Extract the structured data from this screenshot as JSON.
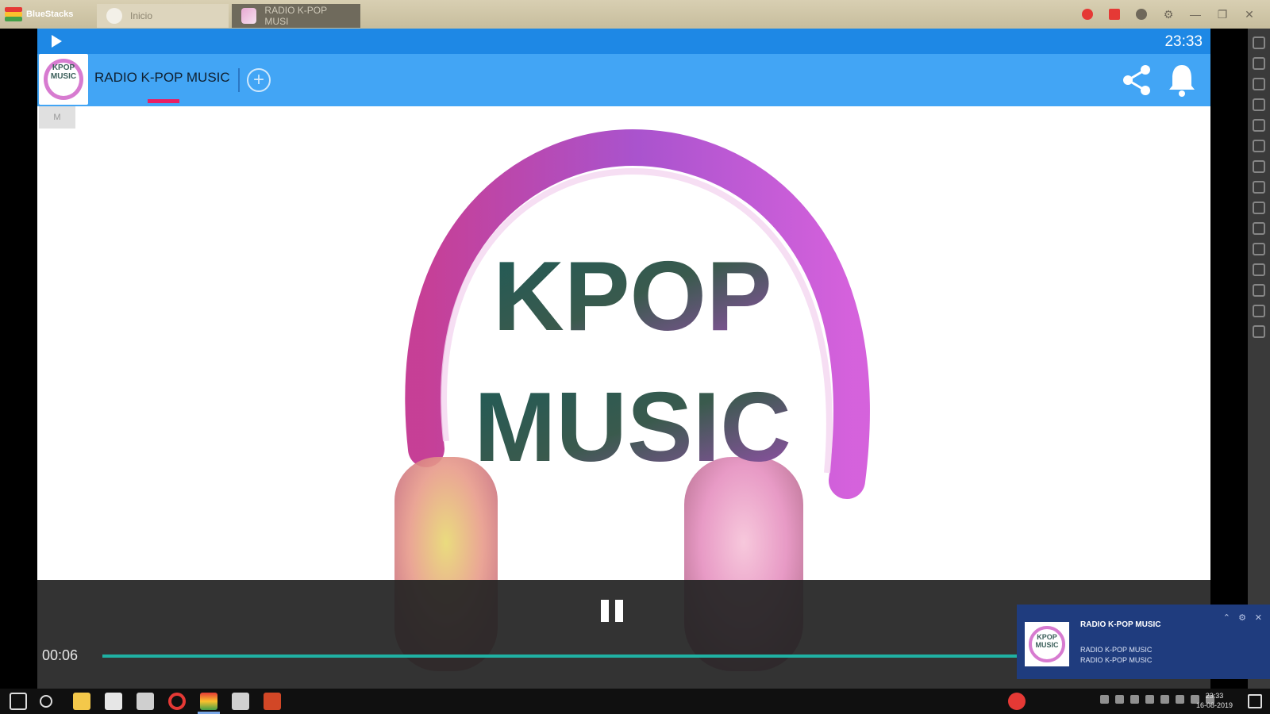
{
  "bluestacks": {
    "brand": "BlueStacks",
    "tabs": [
      {
        "label": "Inicio"
      },
      {
        "label": "RADIO K-POP MUSI"
      }
    ]
  },
  "statusbar": {
    "time": "23:33"
  },
  "app": {
    "title": "RADIO K-POP MUSIC",
    "logo_text": "KPOP MUSIC",
    "artwork_line1": "KPOP",
    "artwork_line2": "MUSIC",
    "tile_label": "M"
  },
  "player": {
    "elapsed": "00:06",
    "progress": 0.88
  },
  "toast": {
    "title": "RADIO K-POP MUSIC",
    "line1": "RADIO K-POP MUSIC",
    "line2": "RADIO K-POP MUSIC",
    "thumb_text": "KPOP MUSIC"
  },
  "clock": {
    "time": "23:33",
    "date": "16-08-2019"
  },
  "colors": {
    "status_bar": "#1e88e5",
    "app_bar": "#42a5f5",
    "tab_indicator": "#e91e63",
    "progress": "#1fb1a3",
    "toast_bg": "#1f3c7e"
  },
  "icons": {
    "share": "share-icon",
    "bell": "bell-icon",
    "pause": "pause-icon",
    "play": "play-icon",
    "add": "add-icon"
  }
}
